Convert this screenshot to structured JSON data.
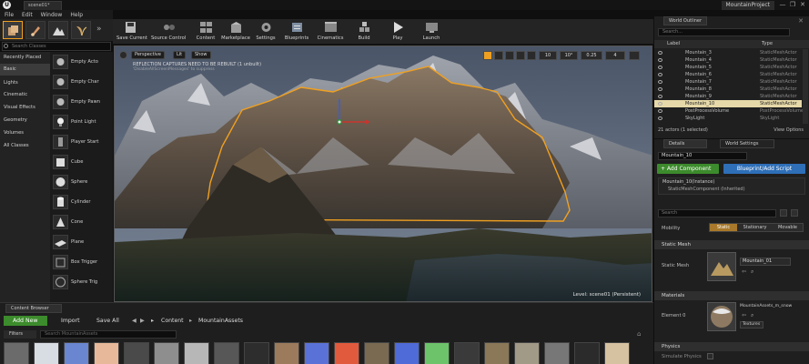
{
  "titlebar": {
    "logo": "U",
    "tab_label": "scene01*",
    "project_name": "MountainProject",
    "window_buttons": [
      "—",
      "❐",
      "✕"
    ]
  },
  "menu": [
    "File",
    "Edit",
    "Window",
    "Help"
  ],
  "modes": {
    "tiles": [
      "place-mode-icon",
      "paint-mode-icon",
      "landscape-mode-icon",
      "foliage-mode-icon"
    ],
    "search_placeholder": "Search Classes"
  },
  "place_categories": [
    "Recently Placed",
    "Basic",
    "Lights",
    "Cinematic",
    "Visual Effects",
    "Geometry",
    "Volumes",
    "All Classes"
  ],
  "place_actors": [
    "Empty Acto",
    "Empty Char",
    "Empty Pawn",
    "Point Light",
    "Player Start",
    "Cube",
    "Sphere",
    "Cylinder",
    "Cone",
    "Plane",
    "Box Trigger",
    "Sphere Trig"
  ],
  "toolbar": {
    "buttons": [
      {
        "label": "Save Current",
        "icon": "save-icon"
      },
      {
        "label": "Source Control",
        "icon": "source-control-icon"
      },
      {
        "label": "Content",
        "icon": "content-icon"
      },
      {
        "label": "Marketplace",
        "icon": "marketplace-icon"
      },
      {
        "label": "Settings",
        "icon": "gear-icon"
      },
      {
        "label": "Blueprints",
        "icon": "blueprints-icon"
      },
      {
        "label": "Cinematics",
        "icon": "cinematics-icon"
      },
      {
        "label": "Build",
        "icon": "build-icon"
      },
      {
        "label": "Play",
        "icon": "play-icon"
      },
      {
        "label": "Launch",
        "icon": "launch-icon"
      }
    ]
  },
  "viewport": {
    "perspective": "Perspective",
    "lit": "Lit",
    "show": "Show",
    "warning": "REFLECTION CAPTURES NEED TO BE REBUILT (1 unbuilt)",
    "warning_sub": "'DisableAllScreenMessages' to suppress",
    "snap_values": [
      "10",
      "10°",
      "0.25",
      "4"
    ],
    "level_label": "Level:  scene01 (Persistent)"
  },
  "outliner": {
    "tab_label": "World Outliner",
    "search_placeholder": "Search...",
    "col_label": "Label",
    "col_type": "Type",
    "rows": [
      {
        "name": "Mountain_3",
        "type": "StaticMeshActor"
      },
      {
        "name": "Mountain_4",
        "type": "StaticMeshActor"
      },
      {
        "name": "Mountain_5",
        "type": "StaticMeshActor"
      },
      {
        "name": "Mountain_6",
        "type": "StaticMeshActor"
      },
      {
        "name": "Mountain_7",
        "type": "StaticMeshActor"
      },
      {
        "name": "Mountain_8",
        "type": "StaticMeshActor"
      },
      {
        "name": "Mountain_9",
        "type": "StaticMeshActor"
      },
      {
        "name": "Mountain_10",
        "type": "StaticMeshActor"
      },
      {
        "name": "PostProcessVolume",
        "type": "PostProcessVolume"
      },
      {
        "name": "SkyLight",
        "type": "SkyLight"
      }
    ],
    "selected_index": 7,
    "actor_count": "21 actors (1 selected)",
    "view_options": "View Options"
  },
  "details": {
    "tab_details": "Details",
    "tab_world": "World Settings",
    "name_value": "Mountain_10",
    "add_component": "+ Add Component",
    "blueprint_button": "Blueprint/Add Script",
    "components": [
      "Mountain_10(Instance)",
      "StaticMeshComponent (Inherited)"
    ],
    "search_placeholder": "Search",
    "mobility_label": "Mobility",
    "mobility_options": [
      "Static",
      "Stationary",
      "Movable"
    ],
    "static_mesh_section": "Static Mesh",
    "static_mesh_label": "Static Mesh",
    "static_mesh_value": "Mountain_01",
    "materials_section": "Materials",
    "element_label": "Element 0",
    "material_value": "MountainAssets_m_snow",
    "textures_label": "Textures",
    "physics_section": "Physics",
    "simulate_label": "Simulate Physics"
  },
  "content_browser": {
    "tab_label": "Content Browser",
    "add_new": "Add New",
    "import": "Import",
    "save_all": "Save All",
    "breadcrumb": [
      "Content",
      "MountainAssets"
    ],
    "filters": "Filters",
    "search_placeholder": "Search MountainAssets"
  },
  "colors": {
    "accent_orange": "#f0a020",
    "add_component_green": "#3c8b2c",
    "blueprint_blue": "#2e6fb8",
    "selection_highlight": "#e6d8a8"
  }
}
